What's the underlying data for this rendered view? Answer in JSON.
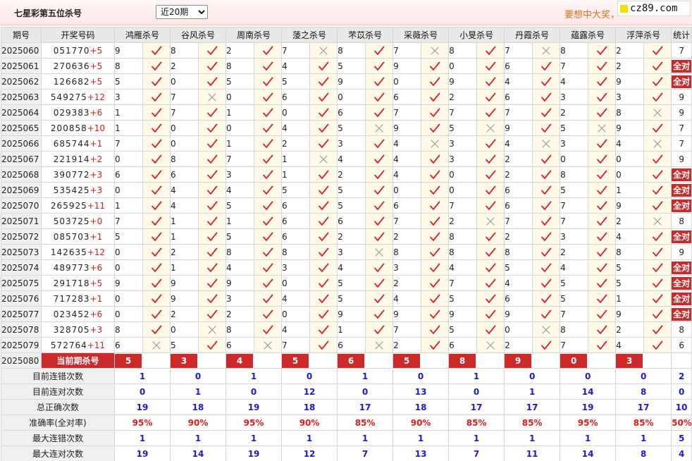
{
  "header": {
    "title": "七星彩第五位杀号",
    "period_selected": "近20期",
    "period_options": [
      "近20期"
    ],
    "slogan": "要想中大奖，",
    "logo_text": "cz89.com"
  },
  "columns": {
    "issue": "期号",
    "draw": "开奖号码",
    "experts": [
      "鸿雁杀号",
      "谷风杀号",
      "周南杀号",
      "蔆之杀号",
      "芣苡杀号",
      "采薇杀号",
      "小旻杀号",
      "丹霞杀号",
      "蕴露杀号",
      "浮萍杀号"
    ],
    "stat": "统计"
  },
  "rows": [
    {
      "issue": "2025060",
      "draw": "051770",
      "bonus": "+5",
      "kills": [
        "9",
        "8",
        "2",
        "7",
        "8",
        "7",
        "8",
        "7",
        "8",
        "2"
      ],
      "marks": [
        1,
        1,
        1,
        0,
        1,
        0,
        1,
        0,
        1,
        1
      ],
      "stat": "7"
    },
    {
      "issue": "2025061",
      "draw": "270636",
      "bonus": "+5",
      "kills": [
        "8",
        "2",
        "8",
        "4",
        "5",
        "9",
        "0",
        "6",
        "7",
        "2"
      ],
      "marks": [
        1,
        1,
        1,
        1,
        1,
        1,
        1,
        1,
        1,
        1
      ],
      "stat": "全对"
    },
    {
      "issue": "2025062",
      "draw": "126682",
      "bonus": "+5",
      "kills": [
        "5",
        "0",
        "5",
        "5",
        "9",
        "0",
        "9",
        "4",
        "4",
        "9"
      ],
      "marks": [
        1,
        1,
        1,
        1,
        1,
        1,
        1,
        1,
        1,
        1
      ],
      "stat": "全对"
    },
    {
      "issue": "2025063",
      "draw": "549275",
      "bonus": "+12",
      "kills": [
        "3",
        "7",
        "0",
        "6",
        "0",
        "6",
        "2",
        "6",
        "3",
        "3"
      ],
      "marks": [
        1,
        0,
        1,
        1,
        1,
        1,
        1,
        1,
        1,
        1
      ],
      "stat": "9"
    },
    {
      "issue": "2025064",
      "draw": "029383",
      "bonus": "+6",
      "kills": [
        "1",
        "7",
        "1",
        "0",
        "6",
        "7",
        "7",
        "7",
        "2",
        "8"
      ],
      "marks": [
        1,
        1,
        1,
        1,
        1,
        1,
        1,
        1,
        1,
        0
      ],
      "stat": "9"
    },
    {
      "issue": "2025065",
      "draw": "200858",
      "bonus": "+10",
      "kills": [
        "1",
        "0",
        "0",
        "4",
        "5",
        "9",
        "5",
        "9",
        "5",
        "9"
      ],
      "marks": [
        1,
        1,
        1,
        1,
        0,
        1,
        0,
        1,
        0,
        1
      ],
      "stat": "7"
    },
    {
      "issue": "2025066",
      "draw": "685744",
      "bonus": "+1",
      "kills": [
        "7",
        "0",
        "1",
        "2",
        "3",
        "4",
        "3",
        "4",
        "3",
        "4"
      ],
      "marks": [
        1,
        1,
        1,
        1,
        1,
        0,
        1,
        0,
        1,
        0
      ],
      "stat": "7"
    },
    {
      "issue": "2025067",
      "draw": "221914",
      "bonus": "+2",
      "kills": [
        "0",
        "8",
        "7",
        "1",
        "4",
        "4",
        "3",
        "2",
        "0",
        "0"
      ],
      "marks": [
        1,
        1,
        1,
        0,
        1,
        1,
        1,
        1,
        1,
        1
      ],
      "stat": "9"
    },
    {
      "issue": "2025068",
      "draw": "390772",
      "bonus": "+3",
      "kills": [
        "6",
        "6",
        "3",
        "1",
        "2",
        "4",
        "0",
        "2",
        "8",
        "0"
      ],
      "marks": [
        1,
        1,
        1,
        1,
        1,
        1,
        1,
        1,
        1,
        1
      ],
      "stat": "全对"
    },
    {
      "issue": "2025069",
      "draw": "535425",
      "bonus": "+3",
      "kills": [
        "0",
        "4",
        "4",
        "5",
        "5",
        "0",
        "0",
        "6",
        "5",
        "1"
      ],
      "marks": [
        1,
        1,
        1,
        1,
        1,
        1,
        1,
        1,
        1,
        1
      ],
      "stat": "全对"
    },
    {
      "issue": "2025070",
      "draw": "265925",
      "bonus": "+11",
      "kills": [
        "1",
        "4",
        "5",
        "6",
        "5",
        "6",
        "7",
        "6",
        "7",
        "9"
      ],
      "marks": [
        1,
        1,
        1,
        1,
        1,
        1,
        1,
        1,
        1,
        1
      ],
      "stat": "全对"
    },
    {
      "issue": "2025071",
      "draw": "503725",
      "bonus": "+0",
      "kills": [
        "7",
        "1",
        "1",
        "6",
        "6",
        "7",
        "2",
        "7",
        "7",
        "2"
      ],
      "marks": [
        1,
        1,
        1,
        1,
        1,
        1,
        0,
        1,
        1,
        0
      ],
      "stat": "8"
    },
    {
      "issue": "2025072",
      "draw": "085703",
      "bonus": "+1",
      "kills": [
        "5",
        "1",
        "5",
        "6",
        "2",
        "2",
        "8",
        "2",
        "3",
        "4"
      ],
      "marks": [
        1,
        1,
        1,
        1,
        1,
        1,
        1,
        1,
        1,
        1
      ],
      "stat": "全对"
    },
    {
      "issue": "2025073",
      "draw": "142635",
      "bonus": "+12",
      "kills": [
        "0",
        "2",
        "8",
        "8",
        "3",
        "8",
        "8",
        "8",
        "2",
        "8"
      ],
      "marks": [
        1,
        1,
        1,
        1,
        0,
        1,
        1,
        1,
        1,
        1
      ],
      "stat": "9"
    },
    {
      "issue": "2025074",
      "draw": "489773",
      "bonus": "+6",
      "kills": [
        "0",
        "1",
        "4",
        "3",
        "4",
        "3",
        "4",
        "5",
        "4",
        "5"
      ],
      "marks": [
        1,
        1,
        1,
        1,
        1,
        1,
        1,
        1,
        1,
        1
      ],
      "stat": "全对"
    },
    {
      "issue": "2025075",
      "draw": "291718",
      "bonus": "+5",
      "kills": [
        "9",
        "9",
        "9",
        "0",
        "5",
        "2",
        "7",
        "4",
        "5",
        "5"
      ],
      "marks": [
        1,
        1,
        1,
        1,
        1,
        1,
        1,
        1,
        1,
        1
      ],
      "stat": "全对"
    },
    {
      "issue": "2025076",
      "draw": "717283",
      "bonus": "+1",
      "kills": [
        "0",
        "9",
        "3",
        "4",
        "5",
        "4",
        "5",
        "6",
        "5",
        "1"
      ],
      "marks": [
        1,
        1,
        1,
        1,
        1,
        1,
        1,
        1,
        1,
        1
      ],
      "stat": "全对"
    },
    {
      "issue": "2025077",
      "draw": "023452",
      "bonus": "+6",
      "kills": [
        "0",
        "2",
        "2",
        "0",
        "9",
        "9",
        "9",
        "9",
        "7",
        "9"
      ],
      "marks": [
        1,
        1,
        1,
        1,
        1,
        1,
        1,
        1,
        1,
        1
      ],
      "stat": "全对"
    },
    {
      "issue": "2025078",
      "draw": "328705",
      "bonus": "+3",
      "kills": [
        "8",
        "0",
        "8",
        "4",
        "1",
        "7",
        "5",
        "0",
        "8",
        "2"
      ],
      "marks": [
        1,
        0,
        1,
        1,
        1,
        1,
        1,
        0,
        1,
        1
      ],
      "stat": "8"
    },
    {
      "issue": "2025079",
      "draw": "572764",
      "bonus": "+11",
      "kills": [
        "6",
        "5",
        "6",
        "7",
        "6",
        "2",
        "6",
        "2",
        "7",
        "4"
      ],
      "marks": [
        0,
        1,
        0,
        1,
        0,
        1,
        0,
        1,
        1,
        1
      ],
      "stat": "6"
    }
  ],
  "current": {
    "issue": "2025080",
    "label": "当前期杀号",
    "kills": [
      "5",
      "3",
      "4",
      "5",
      "6",
      "5",
      "8",
      "9",
      "0",
      "3"
    ]
  },
  "summary": [
    {
      "label": "目前连错次数",
      "values": [
        "1",
        "0",
        "1",
        "0",
        "1",
        "0",
        "1",
        "0",
        "0",
        "0"
      ],
      "stat": "2",
      "color": "blue"
    },
    {
      "label": "目前连对次数",
      "values": [
        "0",
        "1",
        "0",
        "12",
        "0",
        "13",
        "0",
        "1",
        "14",
        "8"
      ],
      "stat": "0",
      "color": "blue"
    },
    {
      "label": "总正确次数",
      "values": [
        "19",
        "18",
        "19",
        "18",
        "17",
        "18",
        "17",
        "17",
        "19",
        "17"
      ],
      "stat": "10",
      "color": "blue"
    },
    {
      "label": "准确率(全对率)",
      "values": [
        "95%",
        "90%",
        "95%",
        "90%",
        "85%",
        "90%",
        "85%",
        "85%",
        "95%",
        "85%"
      ],
      "stat": "50%",
      "color": "red"
    },
    {
      "label": "最大连错次数",
      "values": [
        "1",
        "1",
        "1",
        "1",
        "1",
        "1",
        "1",
        "1",
        "1",
        "1"
      ],
      "stat": "5",
      "color": "blue"
    },
    {
      "label": "最大连对次数",
      "values": [
        "19",
        "14",
        "19",
        "12",
        "7",
        "13",
        "7",
        "11",
        "14",
        "8"
      ],
      "stat": "4",
      "color": "blue"
    }
  ],
  "colors": {
    "accent_red": "#cc2a2a",
    "check_red": "#d8202a",
    "cross_gray": "#9a9a9a",
    "value_blue": "#1a1ad0",
    "slogan_orange": "#e0701a"
  },
  "icons": {
    "hit": "check-icon",
    "miss": "cross-icon"
  }
}
